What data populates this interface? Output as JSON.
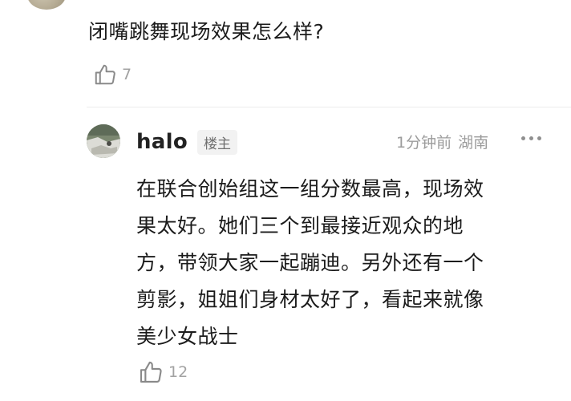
{
  "comment": {
    "text": "闭嘴跳舞现场效果怎么样?",
    "like_count": "7"
  },
  "reply": {
    "username": "halo",
    "badge": "楼主",
    "time": "1分钟前",
    "location": "湖南",
    "lines": [
      "在联合创始组这一组分数最高，现场效",
      "果太好。她们三个到最接近观众的地",
      "方，带领大家一起蹦迪。另外还有一个",
      "剪影，姐姐们身材太好了，看起来就像",
      "美少女战士"
    ],
    "like_count": "12"
  },
  "icons": {
    "like": "thumbs-up-icon",
    "more": "more-dots-icon"
  }
}
